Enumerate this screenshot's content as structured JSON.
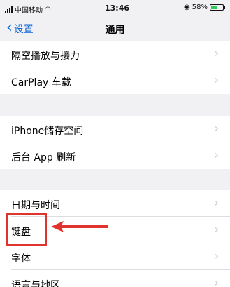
{
  "status_bar": {
    "carrier": "中国移动",
    "time": "13:46",
    "battery_percent": "58%",
    "battery_level": 58,
    "icons": [
      "signal-icon",
      "wifi-icon",
      "rotation-lock-icon",
      "battery-icon"
    ]
  },
  "nav": {
    "back_label": "设置",
    "title": "通用",
    "accent_color": "#0a63d6"
  },
  "groups": [
    {
      "items": [
        {
          "label": "隔空播放与接力"
        },
        {
          "label": "CarPlay 车载"
        }
      ]
    },
    {
      "items": [
        {
          "label": "iPhone储存空间"
        },
        {
          "label": "后台 App 刷新"
        }
      ]
    },
    {
      "items": [
        {
          "label": "日期与时间"
        },
        {
          "label": "键盘"
        },
        {
          "label": "字体"
        },
        {
          "label": "语言与地区"
        }
      ]
    }
  ],
  "chevron": "›",
  "annotation_color": "#e0332e"
}
